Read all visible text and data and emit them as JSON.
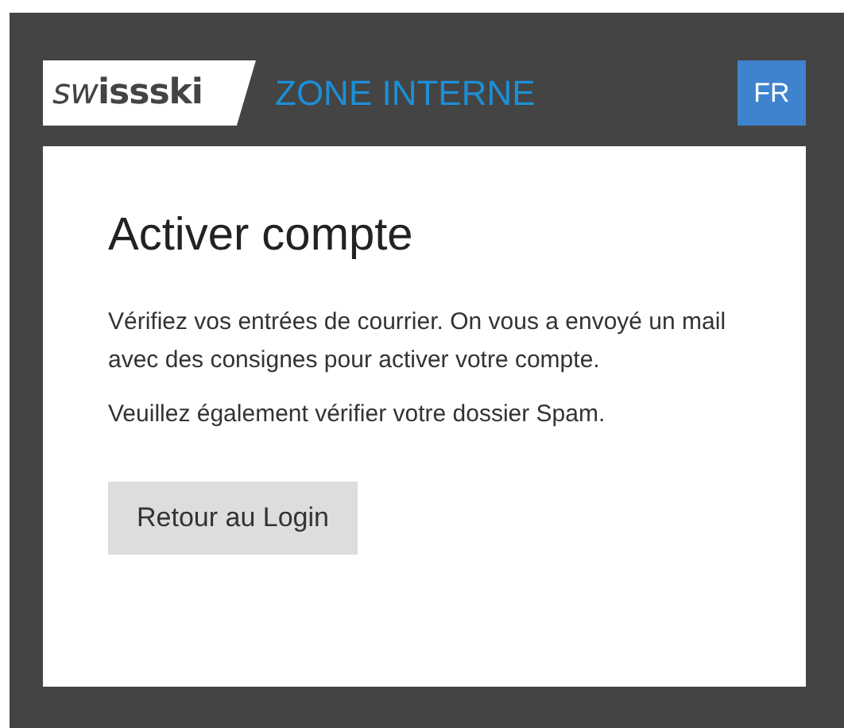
{
  "header": {
    "logo": "sw**issski**",
    "zone_title": "ZONE INTERNE",
    "language_button": "FR"
  },
  "card": {
    "title": "Activer compte",
    "paragraphs": [
      "Vérifiez vos entrées de courrier. On vous a envoyé un mail avec des consignes pour activer votre compte.",
      "Veuillez également vérifier votre dossier Spam."
    ],
    "button": "Retour au Login"
  }
}
